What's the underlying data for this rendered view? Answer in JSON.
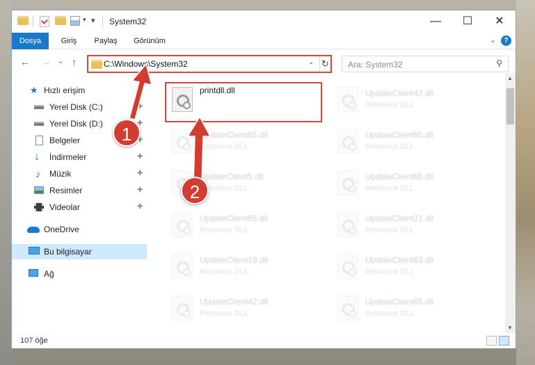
{
  "window": {
    "title": "System32",
    "min_glyph": "—",
    "max_glyph": "☐",
    "close_glyph": "✕"
  },
  "ribbon": {
    "tabs": [
      "Dosya",
      "Giriş",
      "Paylaş",
      "Görünüm"
    ],
    "expand_glyph": "⌄",
    "help_glyph": "?"
  },
  "nav": {
    "back_glyph": "←",
    "forward_glyph": "→",
    "recent_glyph": "⌄",
    "up_glyph": "↑",
    "address": "C:\\Windows\\System32",
    "address_drop_glyph": "⌄",
    "refresh_glyph": "↻",
    "search_placeholder": "Ara: System32",
    "search_glyph": "⚲"
  },
  "sidebar": {
    "items": [
      {
        "label": "Hızlı erişim",
        "icon": "star-icon",
        "pinned": false
      },
      {
        "label": "Yerel Disk (C:)",
        "icon": "drive-icon",
        "pinned": true
      },
      {
        "label": "Yerel Disk (D:)",
        "icon": "drive-icon",
        "pinned": true
      },
      {
        "label": "Belgeler",
        "icon": "documents-icon",
        "pinned": true
      },
      {
        "label": "İndirmeler",
        "icon": "download-icon",
        "pinned": true
      },
      {
        "label": "Müzik",
        "icon": "music-icon",
        "pinned": true
      },
      {
        "label": "Resimler",
        "icon": "pictures-icon",
        "pinned": true
      },
      {
        "label": "Videolar",
        "icon": "videos-icon",
        "pinned": true
      },
      {
        "label": "OneDrive",
        "icon": "cloud-icon",
        "pinned": false
      },
      {
        "label": "Bu bilgisayar",
        "icon": "computer-icon",
        "pinned": false,
        "selected": true
      },
      {
        "label": "Ağ",
        "icon": "network-icon",
        "pinned": false
      }
    ],
    "pin_glyph": "✚"
  },
  "files": {
    "highlighted": {
      "name": "printdll.dll",
      "type": ""
    },
    "left_column": [
      {
        "name": "UpdateClient65.dll",
        "type": "Resource DLL"
      },
      {
        "name": "UpdateClient5.dll",
        "type": "Resource DLL"
      },
      {
        "name": "UpdateClient65.dll",
        "type": "Resource DLL"
      },
      {
        "name": "UpdateClient19.dll",
        "type": "Resource DLL"
      },
      {
        "name": "UpdateClient42.dll",
        "type": "Resource DLL"
      }
    ],
    "right_column": [
      {
        "name": "UpdateClient42.dll",
        "type": "Resource DLL"
      },
      {
        "name": "UpdateClient65.dll",
        "type": "Resource DLL"
      },
      {
        "name": "UpdateClient65.dll",
        "type": "Resource DLL"
      },
      {
        "name": "UpdateClient21.dll",
        "type": "Resource DLL"
      },
      {
        "name": "UpdateClient63.dll",
        "type": "Resource DLL"
      },
      {
        "name": "UpdateClient65.dll",
        "type": "Resource DLL"
      }
    ]
  },
  "status": {
    "item_count": "107 öğe"
  },
  "annotations": {
    "step1": "1",
    "step2": "2",
    "color": "#d23c31"
  },
  "colors": {
    "accent": "#1979ca",
    "highlight": "#d9453a",
    "selection": "#cde8ff"
  }
}
